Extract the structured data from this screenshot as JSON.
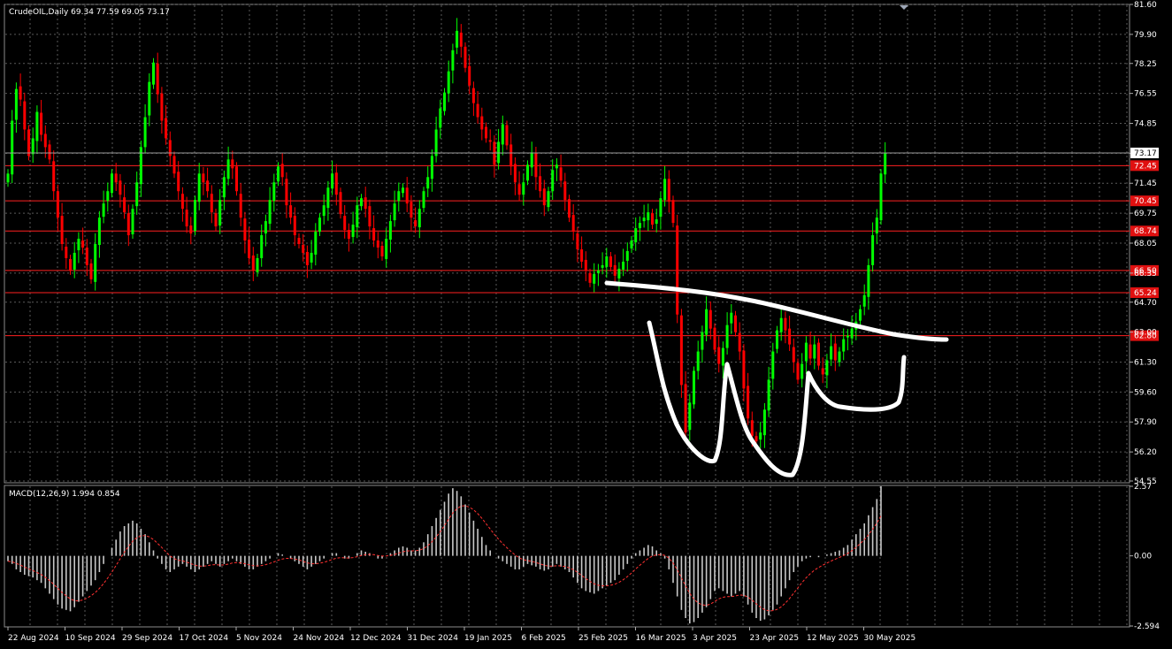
{
  "chart_header": "CrudeOIL,Daily  69.34 77.59 69.05 73.17",
  "macd_header": "MACD(12,26,9) 1.994 0.854",
  "colors": {
    "background": "#000000",
    "grid": "#5a5a5a",
    "bull": "#00ff00",
    "bear": "#ff0000",
    "level_line": "#ff2020",
    "histogram": "#c8c8c8",
    "signal": "#ff3030",
    "drawing": "#ffffff"
  },
  "chart_data": {
    "type": "candlestick",
    "price_axis": {
      "ylim": [
        54.55,
        81.6
      ],
      "ticks": [
        "81.60",
        "79.90",
        "78.25",
        "76.55",
        "74.85",
        "73.15",
        "71.45",
        "69.75",
        "68.05",
        "66.35",
        "64.70",
        "63.00",
        "61.30",
        "59.60",
        "57.90",
        "56.20",
        "54.55"
      ]
    },
    "current_price": "73.17",
    "levels": [
      {
        "label": "72.45",
        "value": 72.45
      },
      {
        "label": "70.45",
        "value": 70.45
      },
      {
        "label": "68.74",
        "value": 68.74
      },
      {
        "label": "66.50",
        "value": 66.5
      },
      {
        "label": "65.24",
        "value": 65.24
      },
      {
        "label": "62.80",
        "value": 62.8
      }
    ],
    "x_axis_labels": [
      "22 Aug 2024",
      "10 Sep 2024",
      "29 Sep 2024",
      "17 Oct 2024",
      "5 Nov 2024",
      "24 Nov 2024",
      "12 Dec 2024",
      "31 Dec 2024",
      "19 Jan 2025",
      "6 Feb 2025",
      "25 Feb 2025",
      "16 Mar 2025",
      "3 Apr 2025",
      "23 Apr 2025",
      "12 May 2025",
      "30 May 2025"
    ],
    "closes": [
      72,
      75,
      76.8,
      76.2,
      74.5,
      73,
      74,
      75.5,
      74.2,
      73.5,
      72.8,
      71,
      69.5,
      68,
      67.2,
      66.5,
      67.5,
      68.3,
      67.8,
      66.8,
      66,
      68,
      69.5,
      70.3,
      71,
      72,
      71.5,
      70.8,
      69.8,
      68.5,
      70,
      71.5,
      73.5,
      75.2,
      77.2,
      78.3,
      76.5,
      75,
      74,
      73,
      72,
      71,
      70,
      69,
      68.6,
      70.5,
      72,
      71.5,
      71,
      69.8,
      69,
      70.5,
      71.8,
      72.8,
      72.3,
      71,
      69.5,
      68.2,
      67.2,
      66.5,
      67.2,
      68.5,
      69.3,
      70.5,
      71.5,
      72.4,
      71.8,
      70.2,
      69.5,
      68.5,
      68,
      67.5,
      66.8,
      67.5,
      68.7,
      69.5,
      70.2,
      71.2,
      72,
      70.8,
      69.7,
      68.8,
      68.3,
      69.1,
      70.2,
      70.6,
      70,
      69,
      68.2,
      67.8,
      67.3,
      68.3,
      69.3,
      70.3,
      71,
      71.2,
      70.3,
      69.5,
      69,
      70,
      71,
      71.8,
      73,
      74.5,
      75.7,
      76.6,
      77.8,
      79,
      80.1,
      79.2,
      78,
      77,
      76,
      75.2,
      74.5,
      74,
      73.8,
      72.5,
      73.8,
      74.8,
      73.6,
      72.4,
      71.5,
      70.8,
      71.5,
      72.5,
      73.2,
      71.8,
      71,
      70.2,
      71,
      72.2,
      72.5,
      71.6,
      70.5,
      69.5,
      68.7,
      67.7,
      67,
      66.5,
      65.8,
      66.3,
      66.5,
      66.8,
      67.3,
      66.7,
      66.2,
      66.6,
      67,
      67.6,
      68.2,
      68.9,
      69.2,
      69.5,
      69.8,
      69.1,
      69.4,
      70.6,
      71.7,
      70.4,
      69.2,
      64,
      60,
      57.3,
      59,
      60.8,
      61.9,
      63,
      64.3,
      63.2,
      62,
      61.2,
      62.1,
      63.4,
      64.1,
      63,
      61.9,
      59.8,
      58.1,
      57.1,
      56.8,
      57.3,
      58.6,
      60.3,
      61.9,
      63.1,
      63.8,
      63.1,
      62.3,
      61.3,
      60.3,
      61.2,
      62.4,
      61.5,
      62.3,
      61.1,
      60.6,
      61.4,
      62.2,
      61.4,
      61.9,
      62.6,
      62.8,
      63.2,
      63.6,
      64.3,
      65.1,
      66.8,
      68.5,
      69.5,
      72,
      73.17
    ],
    "macd_axis": {
      "ylim": [
        -2.594,
        2.57
      ],
      "ticks": [
        "2.57",
        "0.00",
        "-2.594"
      ]
    },
    "macd_hist": [
      -0.2,
      -0.3,
      -0.5,
      -0.6,
      -0.7,
      -0.75,
      -0.8,
      -0.9,
      -1.0,
      -1.2,
      -1.4,
      -1.6,
      -1.8,
      -1.95,
      -2.0,
      -2.05,
      -1.9,
      -1.7,
      -1.5,
      -1.3,
      -1.1,
      -0.9,
      -0.6,
      -0.3,
      0,
      0.3,
      0.6,
      0.9,
      1.1,
      1.2,
      1.3,
      1.2,
      1.0,
      0.8,
      0.5,
      0.2,
      -0.1,
      -0.3,
      -0.5,
      -0.6,
      -0.5,
      -0.4,
      -0.3,
      -0.4,
      -0.5,
      -0.6,
      -0.5,
      -0.4,
      -0.3,
      -0.2,
      -0.3,
      -0.4,
      -0.3,
      -0.2,
      -0.1,
      -0.2,
      -0.3,
      -0.4,
      -0.5,
      -0.5,
      -0.4,
      -0.3,
      -0.2,
      -0.1,
      0,
      0.1,
      0.05,
      0,
      -0.1,
      -0.2,
      -0.3,
      -0.4,
      -0.5,
      -0.4,
      -0.3,
      -0.2,
      -0.1,
      0,
      0.1,
      0.1,
      0,
      -0.1,
      -0.1,
      0,
      0.1,
      0.2,
      0.15,
      0.1,
      0,
      -0.1,
      -0.1,
      0,
      0.1,
      0.2,
      0.3,
      0.35,
      0.3,
      0.2,
      0.2,
      0.3,
      0.5,
      0.8,
      1.1,
      1.4,
      1.7,
      2.0,
      2.3,
      2.5,
      2.4,
      2.2,
      1.9,
      1.6,
      1.3,
      1.0,
      0.7,
      0.4,
      0.2,
      0,
      -0.1,
      -0.2,
      -0.3,
      -0.4,
      -0.5,
      -0.5,
      -0.4,
      -0.3,
      -0.35,
      -0.4,
      -0.5,
      -0.55,
      -0.5,
      -0.4,
      -0.3,
      -0.4,
      -0.5,
      -0.6,
      -0.8,
      -1.0,
      -1.2,
      -1.3,
      -1.35,
      -1.4,
      -1.3,
      -1.2,
      -1.1,
      -1.0,
      -0.9,
      -0.7,
      -0.5,
      -0.3,
      -0.1,
      0.1,
      0.2,
      0.3,
      0.4,
      0.35,
      0.2,
      0.1,
      -0.1,
      -0.5,
      -1.0,
      -1.5,
      -2.0,
      -2.3,
      -2.5,
      -2.45,
      -2.3,
      -2.1,
      -1.9,
      -1.6,
      -1.3,
      -1.2,
      -1.3,
      -1.4,
      -1.5,
      -1.4,
      -1.3,
      -1.5,
      -1.8,
      -2.1,
      -2.3,
      -2.4,
      -2.35,
      -2.2,
      -2.0,
      -1.8,
      -1.5,
      -1.2,
      -0.9,
      -0.6,
      -0.4,
      -0.2,
      -0.1,
      -0.05,
      0,
      -0.05,
      0,
      0.05,
      0.1,
      0.15,
      0.2,
      0.3,
      0.4,
      0.6,
      0.8,
      1.0,
      1.2,
      1.5,
      1.8,
      2.1,
      2.57
    ]
  }
}
